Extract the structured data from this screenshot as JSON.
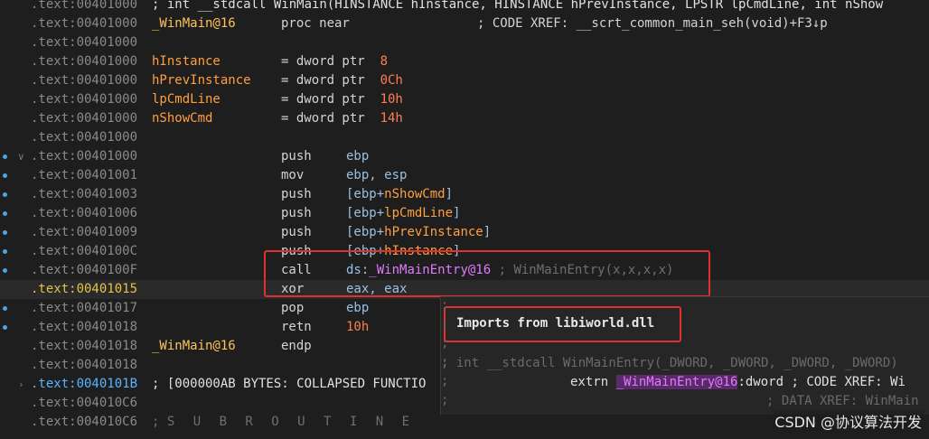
{
  "listing": [
    {
      "addr": ".text:00401000",
      "c1": "; int __stdcall WinMain(HINSTANCE hInstance, HINSTANCE hPrevInstance, LPSTR lpCmdLine, int nShow",
      "c1cls": "tok-white"
    },
    {
      "addr": ".text:00401000",
      "c1": "_WinMain@16",
      "c1cls": "tok-sym",
      "c2": "proc near",
      "c4": "; CODE XREF: __scrt_common_main_seh(void)+F3↓p",
      "c4cls": "tok-xref"
    },
    {
      "addr": ".text:00401000"
    },
    {
      "addr": ".text:00401000",
      "c1": "hInstance",
      "c1cls": "tok-var",
      "c2": "= dword ptr  8"
    },
    {
      "addr": ".text:00401000",
      "c1": "hPrevInstance",
      "c1cls": "tok-var",
      "c2": "= dword ptr  0Ch"
    },
    {
      "addr": ".text:00401000",
      "c1": "lpCmdLine",
      "c1cls": "tok-var",
      "c2": "= dword ptr  10h"
    },
    {
      "addr": ".text:00401000",
      "c1": "nShowCmd",
      "c1cls": "tok-var",
      "c2": "= dword ptr  14h"
    },
    {
      "addr": ".text:00401000"
    },
    {
      "addr": ".text:00401000",
      "dot": true,
      "fold": "∨",
      "c2": "push",
      "c3": "ebp"
    },
    {
      "addr": ".text:00401001",
      "dot": true,
      "c2": "mov",
      "c3": "ebp, esp"
    },
    {
      "addr": ".text:00401003",
      "dot": true,
      "c2": "push",
      "c3": "[ebp+nShowCmd]"
    },
    {
      "addr": ".text:00401006",
      "dot": true,
      "c2": "push",
      "c3": "[ebp+lpCmdLine]"
    },
    {
      "addr": ".text:00401009",
      "dot": true,
      "c2": "push",
      "c3": "[ebp+hPrevInstance]"
    },
    {
      "addr": ".text:0040100C",
      "dot": true,
      "c2": "push",
      "c3": "[ebp+hInstance]"
    },
    {
      "addr": ".text:0040100F",
      "dot": true,
      "c2": "call",
      "c3": "ds:_WinMainEntry@16",
      "c3x": "; WinMainEntry(x,x,x,x)"
    },
    {
      "addr": ".text:00401015",
      "cur": true,
      "hl": true,
      "c2": "xor",
      "c3": "eax, eax"
    },
    {
      "addr": ".text:00401017",
      "dot": true,
      "c2": "pop",
      "c3": "ebp"
    },
    {
      "addr": ".text:00401018",
      "dot": true,
      "c2": "retn",
      "c3": "10h"
    },
    {
      "addr": ".text:00401018",
      "c1": "_WinMain@16",
      "c1cls": "tok-sym",
      "c2": "endp"
    },
    {
      "addr": ".text:00401018"
    },
    {
      "addr": ".text:0040101B",
      "sel": true,
      "fold": "›",
      "c1": "; [000000AB BYTES: COLLAPSED FUNCTIO",
      "c1cls": "tok-white"
    },
    {
      "addr": ".text:004010C6"
    },
    {
      "addr": ".text:004010C6",
      "c1": "; ",
      "c1cls": "tok-cmt",
      "c1sub": "S U B R O U T I N E"
    }
  ],
  "tooltip": {
    "title": "Imports from libiworld.dll",
    "proto": "; int __stdcall WinMainEntry(_DWORD, _DWORD, _DWORD, _DWORD)",
    "extrn_kw": "extrn",
    "extrn_sym": "_WinMainEntry@16",
    "extrn_type": ":dword",
    "extrn_xref": "; CODE XREF: Wi",
    "data_xref": "; DATA XREF: WinMain",
    "semis": [
      ";",
      ";",
      ";",
      ";",
      ";",
      ";"
    ]
  },
  "watermark": "CSDN @协议算法开发"
}
